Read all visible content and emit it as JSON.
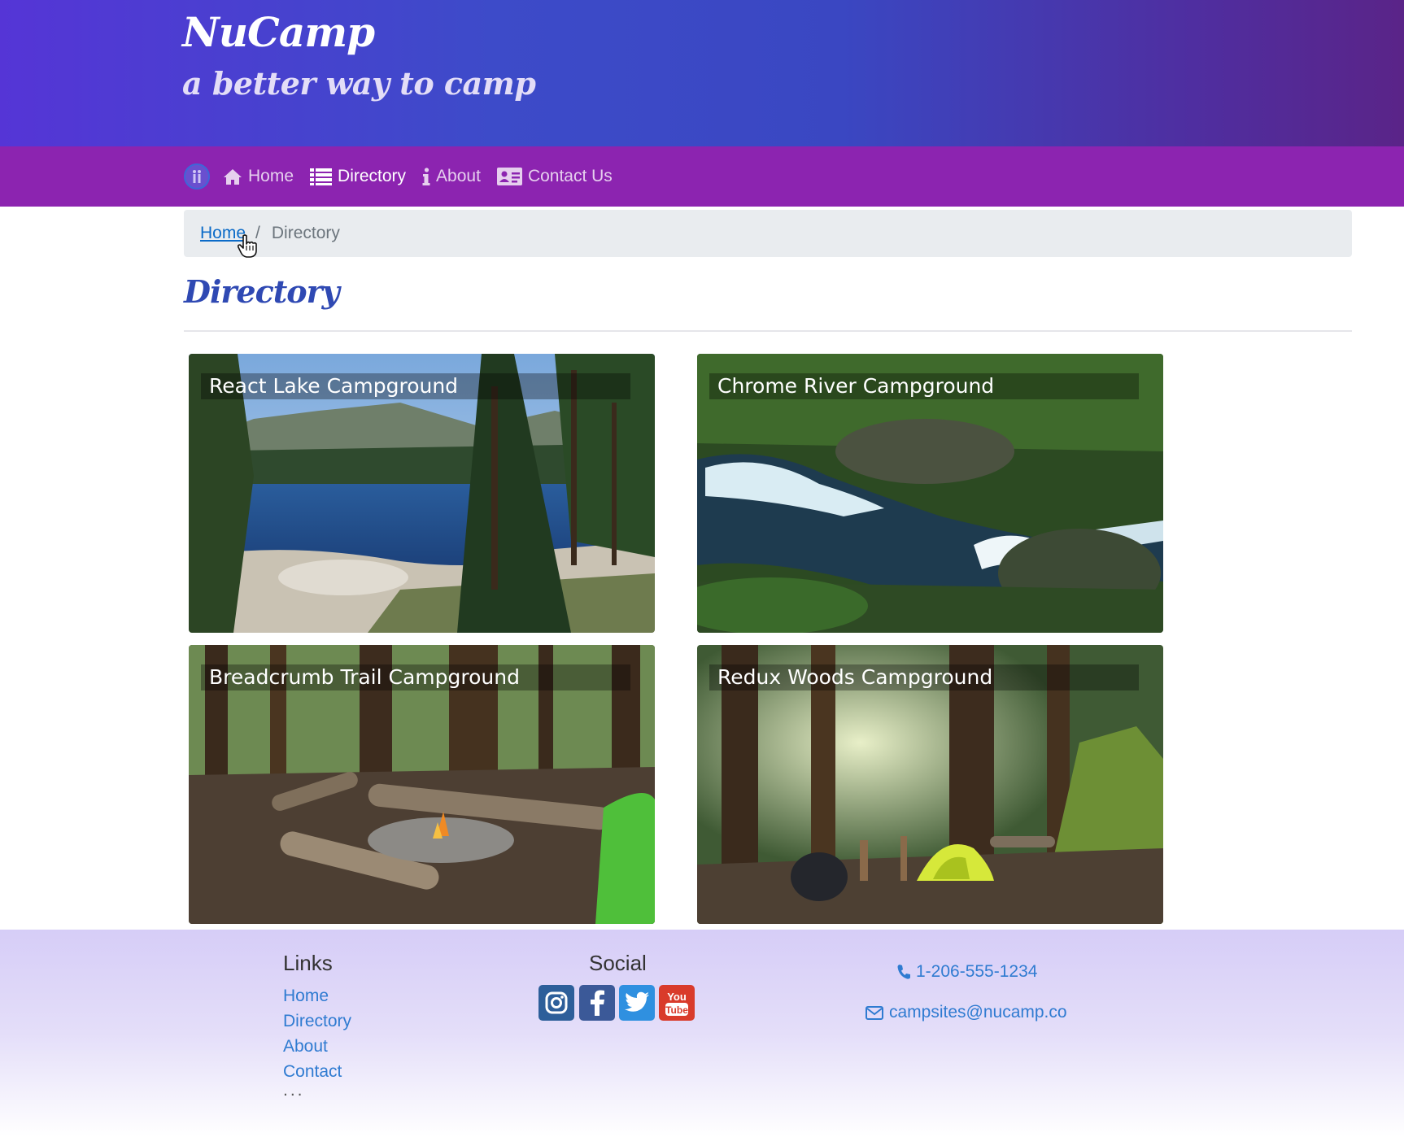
{
  "header": {
    "title": "NuCamp",
    "subtitle": "a better way to camp"
  },
  "nav": {
    "items": [
      {
        "label": "Home",
        "icon": "home-icon",
        "active": false
      },
      {
        "label": "Directory",
        "icon": "list-icon",
        "active": true
      },
      {
        "label": "About",
        "icon": "info-icon",
        "active": false
      },
      {
        "label": "Contact Us",
        "icon": "address-card-icon",
        "active": false
      }
    ]
  },
  "breadcrumb": {
    "home": "Home",
    "separator": "/",
    "current": "Directory"
  },
  "page": {
    "title": "Directory"
  },
  "campsites": [
    {
      "name": "React Lake Campground",
      "image": "lake-photo"
    },
    {
      "name": "Chrome River Campground",
      "image": "river-photo"
    },
    {
      "name": "Breadcrumb Trail Campground",
      "image": "campfire-photo"
    },
    {
      "name": "Redux Woods Campground",
      "image": "forest-tent-photo"
    }
  ],
  "footer": {
    "links_heading": "Links",
    "links": [
      "Home",
      "Directory",
      "About",
      "Contact"
    ],
    "more": "...",
    "social_heading": "Social",
    "social": [
      "instagram-icon",
      "facebook-icon",
      "twitter-icon",
      "youtube-icon"
    ],
    "phone": "1-206-555-1234",
    "email": "campsites@nucamp.co"
  },
  "colors": {
    "jumbotron_start": "#5535d6",
    "jumbotron_end": "#5a2488",
    "navbar": "#8c24b0",
    "link": "#2f7bd1",
    "page_title": "#2f49b3"
  }
}
